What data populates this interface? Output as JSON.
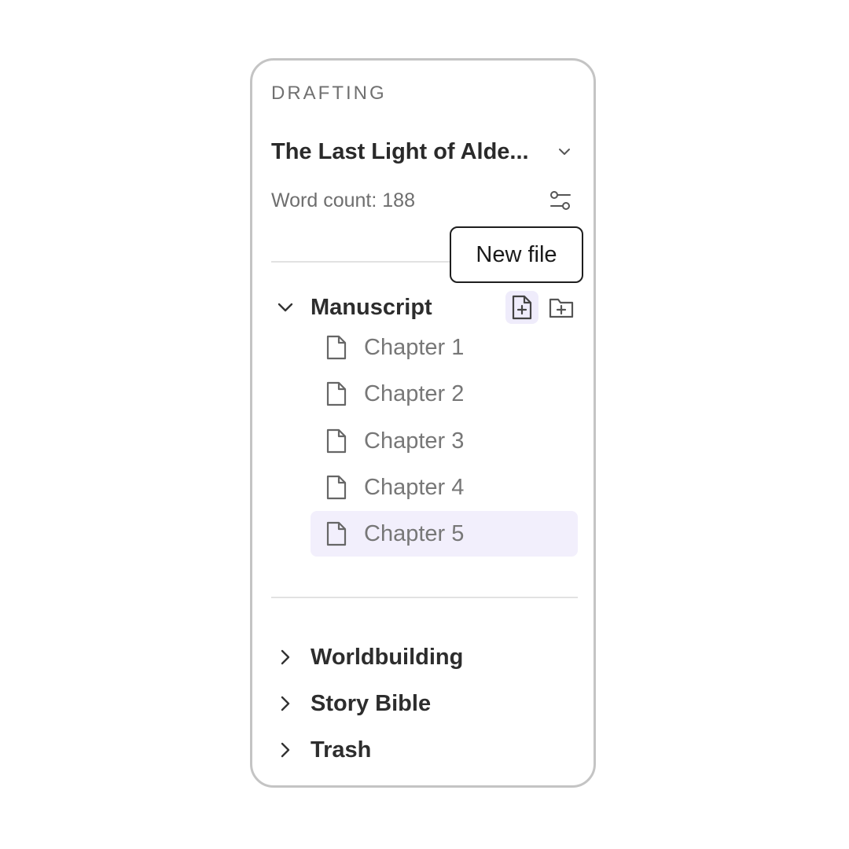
{
  "panel": {
    "section_label": "DRAFTING",
    "project_title": "The Last Light of Alde...",
    "word_count": "Word count: 188"
  },
  "tooltip": {
    "label": "New file"
  },
  "manuscript": {
    "name": "Manuscript",
    "expanded": true,
    "files": [
      {
        "label": "Chapter 1"
      },
      {
        "label": "Chapter 2"
      },
      {
        "label": "Chapter 3"
      },
      {
        "label": "Chapter 4"
      },
      {
        "label": "Chapter 5",
        "selected": true
      }
    ]
  },
  "folders": [
    {
      "name": "Worldbuilding"
    },
    {
      "name": "Story Bible"
    },
    {
      "name": "Trash"
    }
  ],
  "icons": {
    "project_dropdown": "chevron-down-icon",
    "settings": "sliders-icon",
    "new_file": "file-plus-icon",
    "new_folder": "folder-plus-icon",
    "file": "file-icon",
    "collapsed": "chevron-right-icon"
  },
  "colors": {
    "selected_bg": "#f2effc",
    "active_button_bg": "#efecfb",
    "panel_border": "#c4c4c4"
  }
}
